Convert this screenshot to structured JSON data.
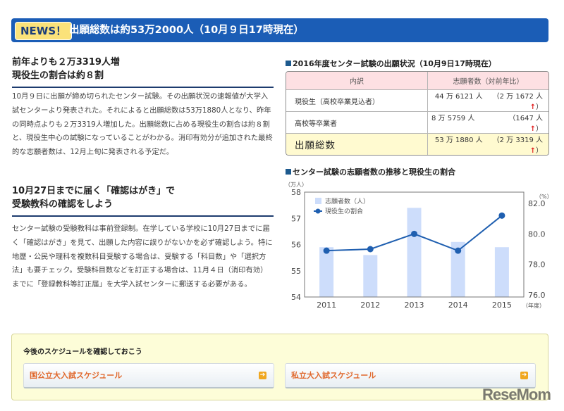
{
  "banner": {
    "badge": "NEWS！",
    "title": "出願総数は約53万2000人（10月９日17時現在）"
  },
  "section1": {
    "heading_line1": "前年よりも２万3319人増",
    "heading_line2": "現役生の割合は約８割",
    "body": "10月９日に出願が締め切られたセンター試験。その出願状況の速報値が大学入試センターより発表された。それによると出願総数は53万1880人となり、昨年の同時点よりも２万3319人増加した。出願総数に占める現役生の割合は約８割と、現役生中心の試験になっていることがわかる。消印有効分が追加された最終的な志願者数は、12月上旬に発表される予定だ。"
  },
  "section2": {
    "heading_line1": "10月27日までに届く「確認はがき」で",
    "heading_line2": "受験教科の確認をしよう",
    "body": "センター試験の受験教科は事前登録制。在学している学校に10月27日までに届く「確認はがき」を見て、出願した内容に誤りがないかを必ず確認しよう。特に地歴・公民や理科を複数科目受験する場合は、受験する「科目数」や「選択方法」も要チェック。受験科目数などを訂正する場合は、11月４日（消印有効）までに「登録教科等訂正届」を大学入試センターに郵送する必要がある。"
  },
  "table": {
    "title": "2016年度センター試験の出願状況（10月9日17時現在）",
    "headers": [
      "内訳",
      "志願者数（対前年比）"
    ],
    "rows": [
      {
        "label": "現役生（高校卒業見込者）",
        "value": "44 万 6121 人",
        "change": "（2 万 1672 人",
        "arrow": "↑",
        "close": "）"
      },
      {
        "label": "高校等卒業者",
        "value": "8 万 5759 人",
        "change": "（1647 人",
        "arrow": "↑",
        "close": "）"
      },
      {
        "label": "出願総数",
        "value": "53 万 1880 人",
        "change": "（2 万 3319 人",
        "arrow": "↑",
        "close": "）"
      }
    ]
  },
  "chart_data": {
    "type": "bar+line",
    "title": "センター試験の志願者数の推移と現役生の割合",
    "categories": [
      "2011",
      "2012",
      "2013",
      "2014",
      "2015"
    ],
    "xlabel": "（年度）",
    "ylabel_left": "（万人）",
    "ylabel_right": "（%）",
    "ylim_left": [
      54,
      58
    ],
    "yticks_left": [
      "54",
      "55",
      "56",
      "57",
      "58"
    ],
    "ylim_right": [
      76,
      82
    ],
    "yticks_right": [
      "76.0",
      "78.0",
      "80.0",
      "82.0"
    ],
    "series": [
      {
        "name": "志願者数（人）",
        "type": "bar",
        "axis": "left",
        "values": [
          55.9,
          55.6,
          57.4,
          56.1,
          55.9
        ],
        "color": "#cdddfb"
      },
      {
        "name": "現役生の割合",
        "type": "line",
        "axis": "right",
        "values": [
          78.9,
          79.0,
          80.0,
          78.9,
          81.2
        ],
        "color": "#1f5fb0"
      }
    ],
    "grid": false,
    "legend": "top-left"
  },
  "schedule": {
    "title": "今後のスケジュールを確認しておこう",
    "buttons": [
      "国公立大入試スケジュール",
      "私立大入試スケジュール"
    ]
  },
  "logo": "ReseMom"
}
